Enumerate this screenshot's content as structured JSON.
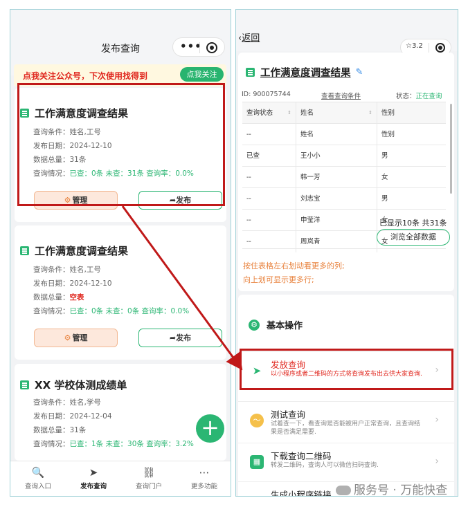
{
  "left": {
    "nav_title": "发布查询",
    "banner": {
      "text": "点我关注公众号，下次使用找得到",
      "button": "点我关注"
    },
    "cards": [
      {
        "title": "工作满意度调查结果",
        "conditions": "查询条件：姓名,工号",
        "date": "发布日期：2024-12-10",
        "total_label": "数据总量：",
        "total_value": "31条",
        "status_label": "查询情况：",
        "status_value": "已查：0条 未查：31条 查询率：0.0%",
        "manage": "管理",
        "publish": "发布"
      },
      {
        "title": "工作满意度调查结果",
        "conditions": "查询条件：姓名,工号",
        "date": "发布日期：2024-12-10",
        "total_label": "数据总量：",
        "total_value": "空表",
        "status_label": "查询情况：",
        "status_value": "已查：0条 未查：0条 查询率：0.0%",
        "manage": "管理",
        "publish": "发布"
      },
      {
        "title": "XX 学校体测成绩单",
        "conditions": "查询条件：姓名,学号",
        "date": "发布日期：2024-12-04",
        "total_label": "数据总量：",
        "total_value": "31条",
        "status_label": "查询情况：",
        "status_value": "已查：1条 未查：30条 查询率：3.2%"
      }
    ],
    "fab": "+",
    "tabs": [
      {
        "icon": "search-icon",
        "glyph": "🔍",
        "label": "查询入口"
      },
      {
        "icon": "send-icon",
        "glyph": "➤",
        "label": "发布查询"
      },
      {
        "icon": "portal-icon",
        "glyph": "⛓",
        "label": "查询门户"
      },
      {
        "icon": "more-icon",
        "glyph": "⋯",
        "label": "更多功能"
      }
    ]
  },
  "right": {
    "back": "返回",
    "star_count": "3.2",
    "result_title": "工作满意度调查结果",
    "id_text": "ID: 900075744",
    "view_conditions": "查看查询条件",
    "state_label": "状态：",
    "state_value": "正在查询",
    "table": {
      "headers": [
        "查询状态",
        "姓名",
        "性别"
      ],
      "rows": [
        [
          "--",
          "姓名",
          "性别"
        ],
        [
          "已查",
          "王小小",
          "男"
        ],
        [
          "--",
          "韩一芳",
          "女"
        ],
        [
          "--",
          "刘志宝",
          "男"
        ],
        [
          "--",
          "申莹洋",
          "女"
        ],
        [
          "--",
          "周岚青",
          "女"
        ]
      ]
    },
    "hint1": "按住表格左右划动看更多的列;",
    "hint2": "向上划可显示更多行;",
    "show_count": "已显示10条 共31条",
    "browse_all": "浏览全部数据",
    "section_title": "基本操作",
    "items": [
      {
        "icon": "send-icon",
        "title": "发放查询",
        "desc": "以小程序或者二维码的方式将查询发布出去供大家查询."
      },
      {
        "icon": "test-icon",
        "title": "测试查询",
        "desc": "试着查一下，看查询是否能被用户正常查询，且查询结果是否满足需要."
      },
      {
        "icon": "qrcode-icon",
        "title": "下载查询二维码",
        "desc": "转发二维码，查询人可以微信扫码查询."
      },
      {
        "icon": "link-icon",
        "title": "生成小程序链接",
        "desc": ""
      }
    ]
  },
  "watermark": "服务号 · 万能快查",
  "colors": {
    "accent": "#2bb673",
    "red": "#e0281f",
    "orange": "#e8823d",
    "annotation": "#c01919"
  }
}
